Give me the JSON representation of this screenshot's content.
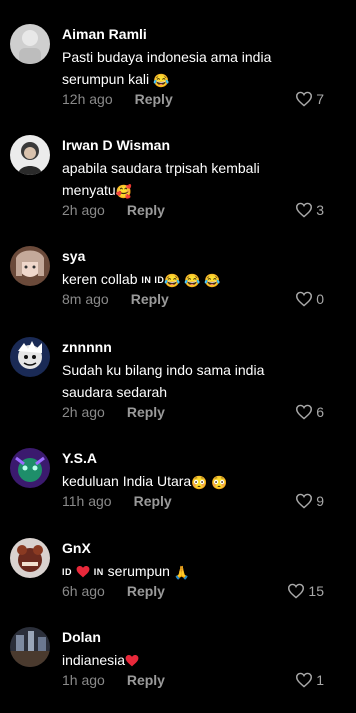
{
  "comments": [
    {
      "username": "Aiman Ramli",
      "text": "Pasti budaya indonesia ama india serumpun kali",
      "emoji": "😂",
      "time": "12h ago",
      "reply": "Reply",
      "likes": "7"
    },
    {
      "username": "Irwan D Wisman",
      "text": "apabila saudara trpisah kembali menyatu",
      "emoji": "🥰",
      "time": "2h ago",
      "reply": "Reply",
      "likes": "3"
    },
    {
      "username": "sya",
      "text": "keren collab",
      "flag": "IN ID",
      "emoji": "😂 😂 😂",
      "time": "8m ago",
      "reply": "Reply",
      "likes": "0"
    },
    {
      "username": "znnnnn",
      "text": "Sudah ku bilang indo sama india saudara sedarah",
      "time": "2h ago",
      "reply": "Reply",
      "likes": "6"
    },
    {
      "username": "Y.S.A",
      "text": "keduluan India Utara",
      "emoji": "😳 😳",
      "time": "11h ago",
      "reply": "Reply",
      "likes": "9"
    },
    {
      "username": "GnX",
      "flag_left": "ID",
      "flag_right": "IN",
      "text": "serumpun",
      "emoji": "🙏",
      "time": "6h ago",
      "reply": "Reply",
      "likes": "15"
    },
    {
      "username": "Dolan",
      "text": "indianesia",
      "time": "1h ago",
      "reply": "Reply",
      "likes": "1"
    }
  ],
  "colors": {
    "background": "#000000",
    "text": "#ffffff",
    "meta": "#8a8a8a",
    "heart_red": "#e8283a"
  },
  "icons": {
    "like": "heart-outline-icon",
    "inline_heart": "red-heart-icon"
  }
}
